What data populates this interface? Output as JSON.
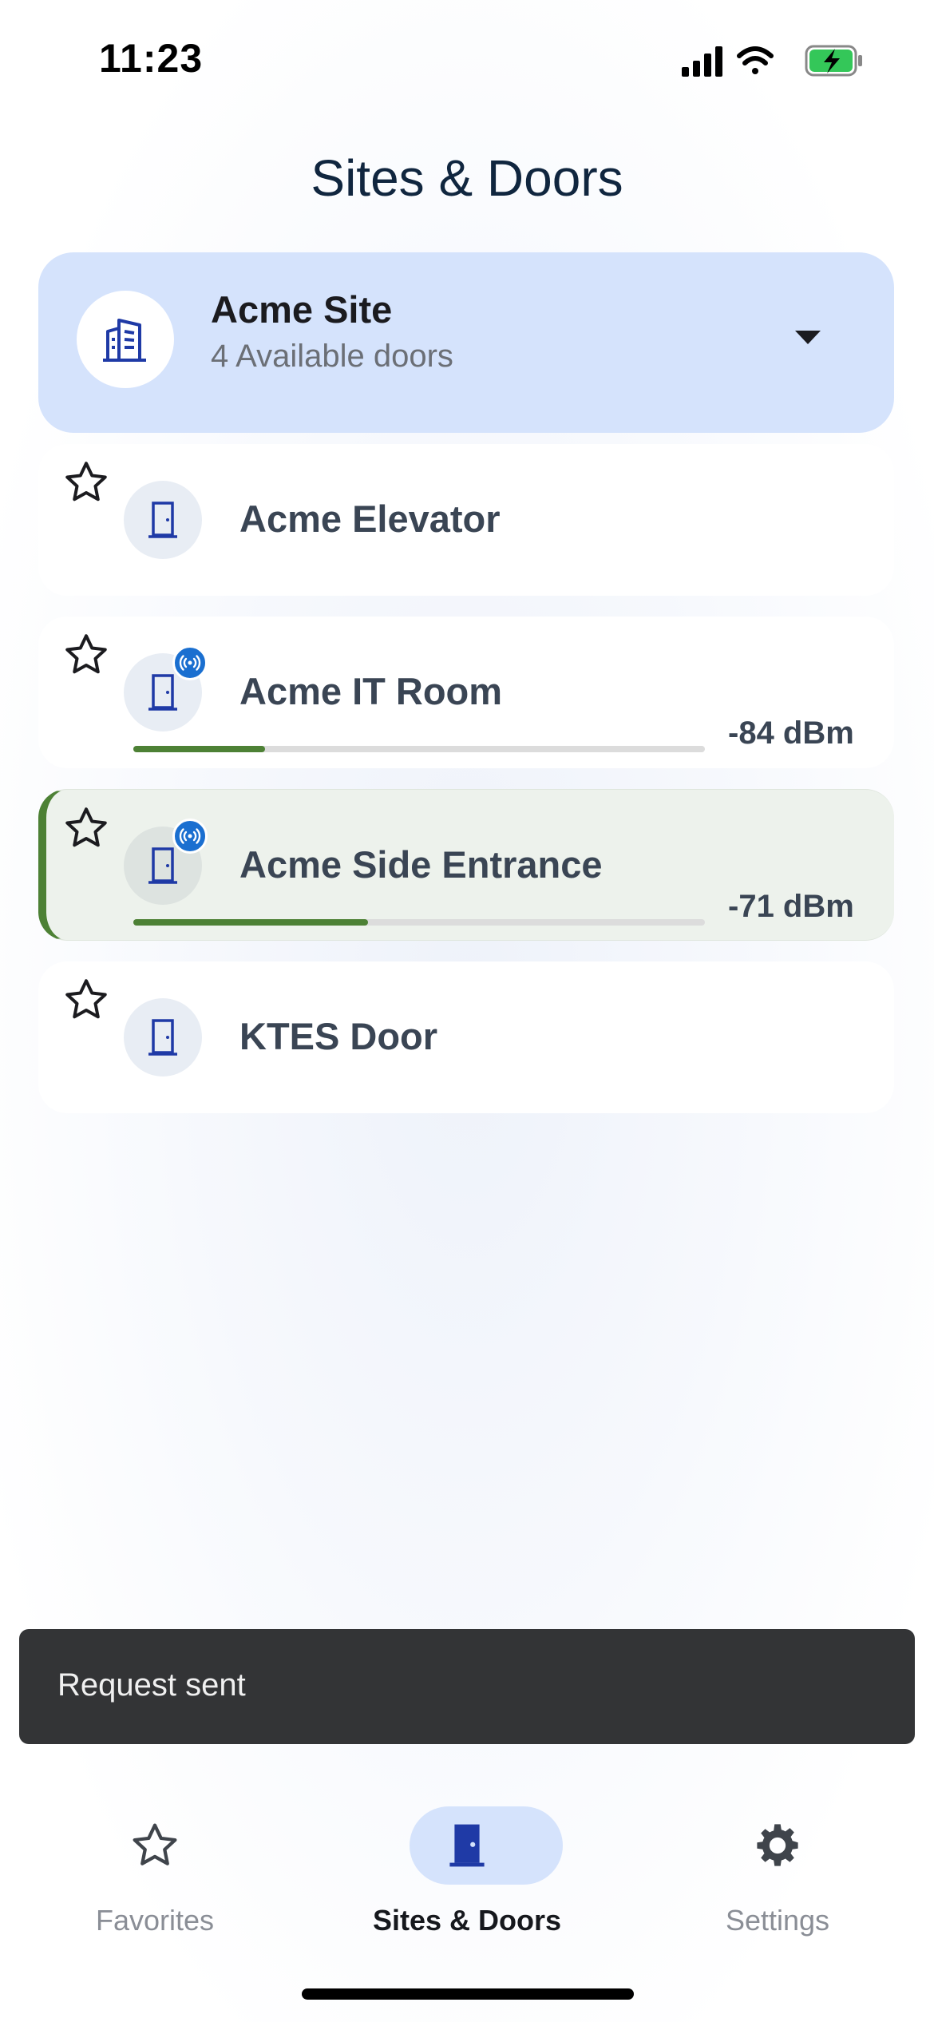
{
  "status_bar": {
    "time": "11:23"
  },
  "page": {
    "title": "Sites & Doors"
  },
  "site": {
    "name": "Acme Site",
    "subtitle": "4 Available doors",
    "icon": "building-icon"
  },
  "doors": [
    {
      "name": "Acme Elevator",
      "favorite": false,
      "bluetooth": false
    },
    {
      "name": "Acme IT Room",
      "favorite": false,
      "bluetooth": true,
      "rssi": "-84 dBm",
      "signal_strength_pct": 23
    },
    {
      "name": "Acme Side Entrance",
      "favorite": false,
      "bluetooth": true,
      "rssi": "-71 dBm",
      "signal_strength_pct": 41,
      "selected": true
    },
    {
      "name": "KTES Door",
      "favorite": false,
      "bluetooth": false
    }
  ],
  "snackbar": {
    "message": "Request sent"
  },
  "bottom_nav": {
    "items": [
      {
        "label": "Favorites",
        "icon": "star-icon",
        "selected": false
      },
      {
        "label": "Sites & Doors",
        "icon": "door-icon",
        "selected": true
      },
      {
        "label": "Settings",
        "icon": "gear-icon",
        "selected": false
      }
    ]
  },
  "colors": {
    "accent_blue": "#1f3aa6",
    "selected_container": "#d5e3fc",
    "signal_green": "#4d8135",
    "bluetooth_badge": "#1a6fd0",
    "battery_green": "#34c759"
  }
}
